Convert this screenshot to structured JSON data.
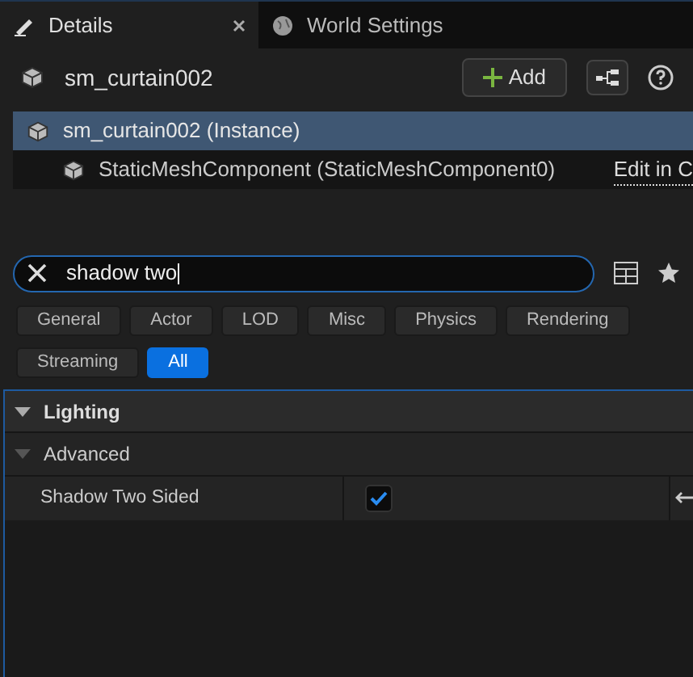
{
  "tabs": [
    {
      "label": "Details",
      "selected": true,
      "closable": true,
      "kind": "details"
    },
    {
      "label": "World Settings",
      "selected": false,
      "closable": false,
      "kind": "world"
    }
  ],
  "header": {
    "title": "sm_curtain002",
    "add_label": "Add"
  },
  "components": [
    {
      "label": "sm_curtain002 (Instance)",
      "selected": true,
      "children": [
        {
          "label": "StaticMeshComponent (StaticMeshComponent0)",
          "selected": false,
          "link": "Edit in C"
        }
      ]
    }
  ],
  "search": {
    "value": "shadow two"
  },
  "filters": [
    {
      "label": "General",
      "selected": false
    },
    {
      "label": "Actor",
      "selected": false
    },
    {
      "label": "LOD",
      "selected": false
    },
    {
      "label": "Misc",
      "selected": false
    },
    {
      "label": "Physics",
      "selected": false
    },
    {
      "label": "Rendering",
      "selected": false
    },
    {
      "label": "Streaming",
      "selected": false
    },
    {
      "label": "All",
      "selected": true
    }
  ],
  "categories": [
    {
      "label": "Lighting",
      "expanded": true,
      "children": [
        {
          "label": "Advanced",
          "expanded": true,
          "properties": [
            {
              "label": "Shadow Two Sided",
              "checked": true
            }
          ]
        }
      ]
    }
  ]
}
